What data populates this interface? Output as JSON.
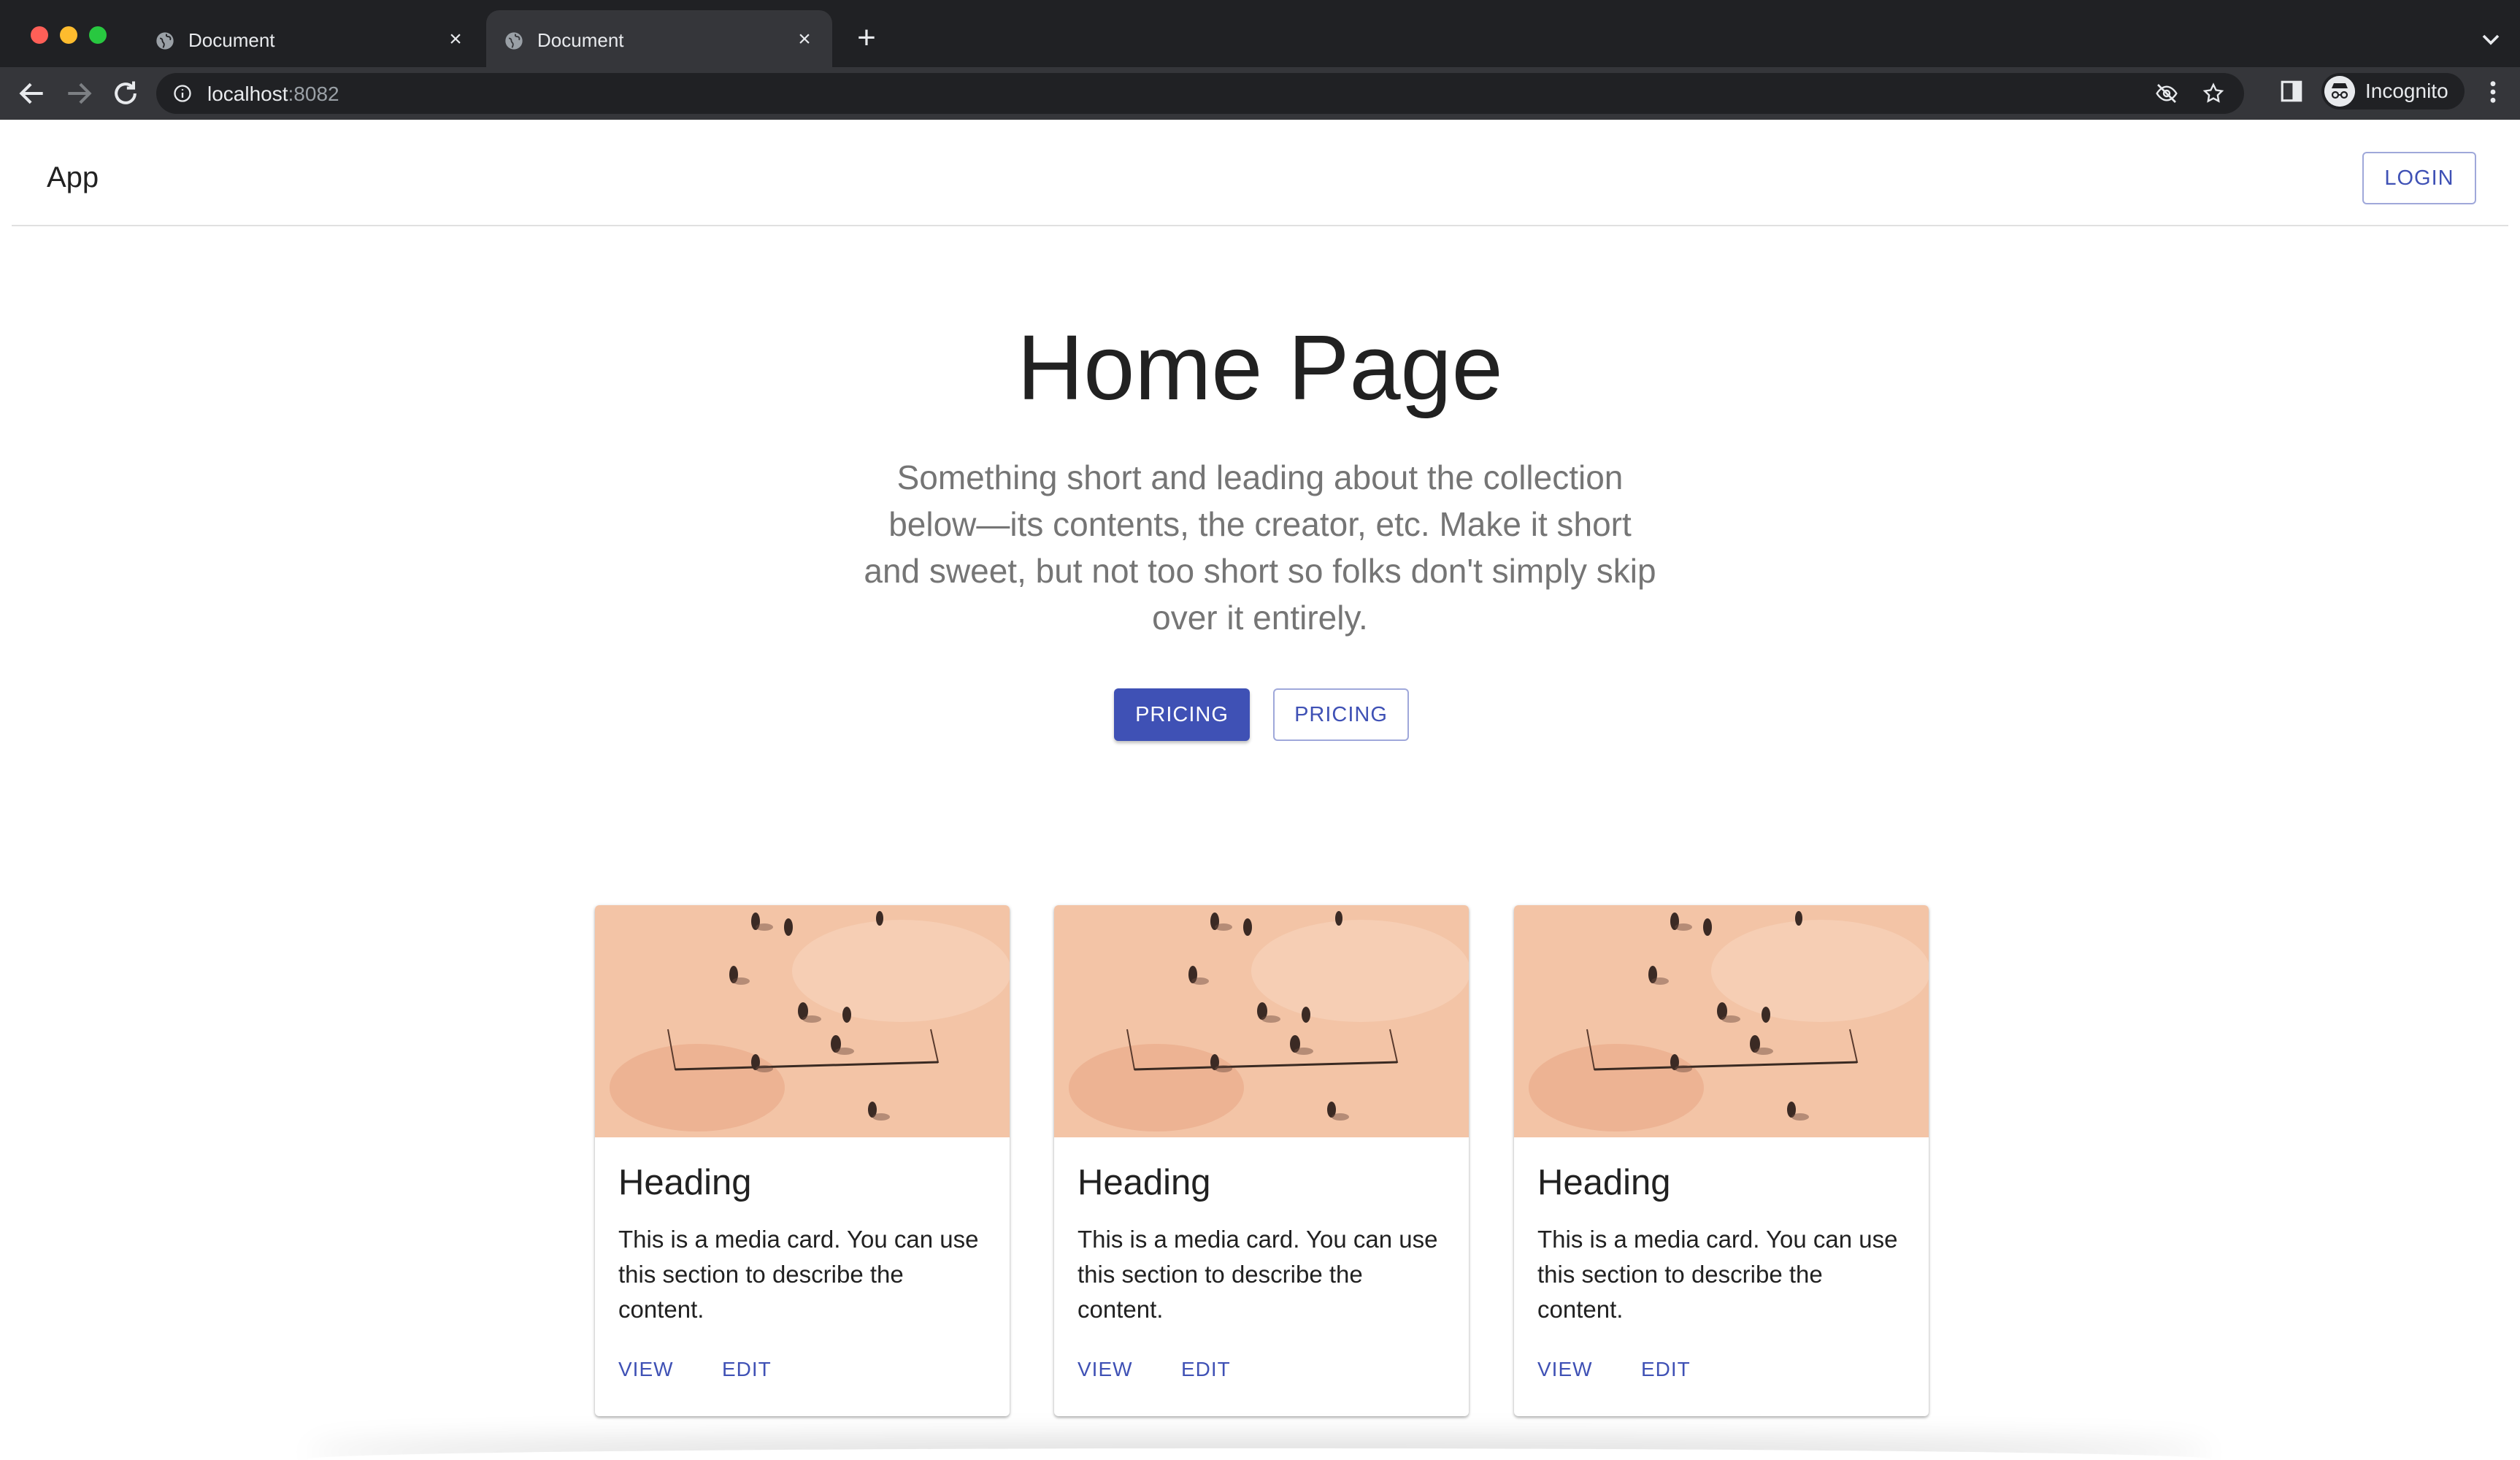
{
  "browser": {
    "tabs": [
      {
        "title": "Document",
        "close": "×"
      },
      {
        "title": "Document",
        "close": "×"
      }
    ],
    "new_tab": "+",
    "url_host": "localhost",
    "url_port": ":8082",
    "profile_label": "Incognito"
  },
  "app": {
    "title": "App",
    "login_label": "LOGIN"
  },
  "hero": {
    "title": "Home Page",
    "subtitle": "Something short and leading about the collection below—its contents, the creator, etc. Make it short and sweet, but not too short so folks don't simply skip over it entirely.",
    "primary_button": "PRICING",
    "secondary_button": "PRICING"
  },
  "cards": [
    {
      "heading": "Heading",
      "text": "This is a media card. You can use this section to describe the content.",
      "view": "VIEW",
      "edit": "EDIT"
    },
    {
      "heading": "Heading",
      "text": "This is a media card. You can use this section to describe the content.",
      "view": "VIEW",
      "edit": "EDIT"
    },
    {
      "heading": "Heading",
      "text": "This is a media card. You can use this section to describe the content.",
      "view": "VIEW",
      "edit": "EDIT"
    }
  ],
  "colors": {
    "primary": "#3f51b5",
    "chrome_dark": "#202124",
    "chrome_toolbar": "#35363a",
    "media_sand": "#f2c2a2"
  }
}
